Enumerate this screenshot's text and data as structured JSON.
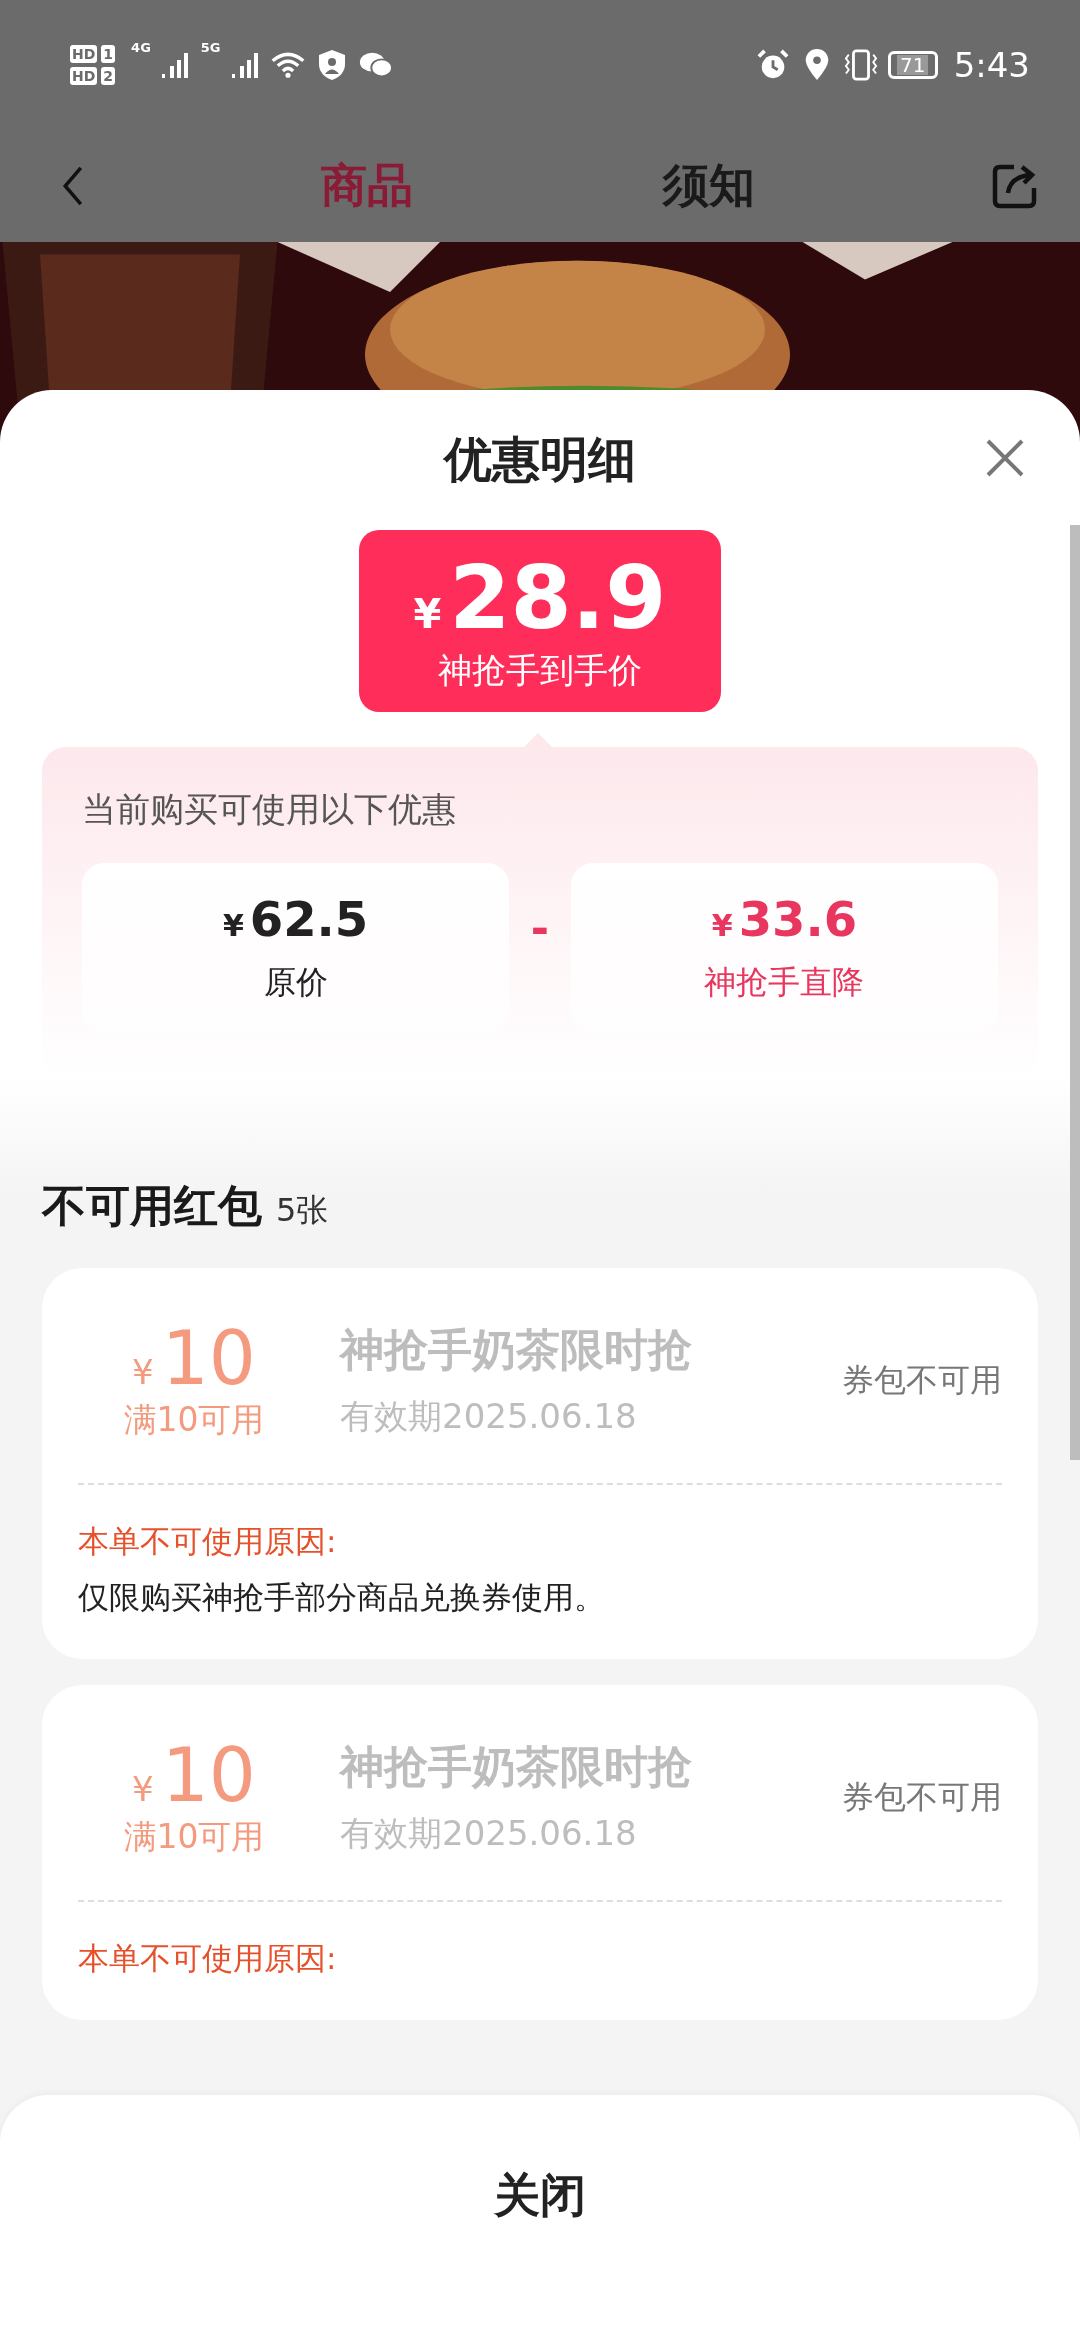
{
  "status_bar": {
    "sims": [
      {
        "hd": "HD",
        "slot": "1",
        "network": "4G"
      },
      {
        "hd": "HD",
        "slot": "2",
        "network": "5G"
      }
    ],
    "battery": "71",
    "time": "5:43"
  },
  "header": {
    "tabs": [
      {
        "label": "商品",
        "selected": true
      },
      {
        "label": "须知",
        "selected": false
      }
    ]
  },
  "sheet": {
    "title": "优惠明细",
    "final_price": {
      "currency": "¥",
      "amount": "28.9",
      "label": "神抢手到手价"
    },
    "discount_panel": {
      "caption": "当前购买可使用以下优惠",
      "operator": "-",
      "items": [
        {
          "currency": "¥",
          "amount": "62.5",
          "label": "原价",
          "kind": "base"
        },
        {
          "currency": "¥",
          "amount": "33.6",
          "label": "神抢手直降",
          "kind": "discount"
        }
      ]
    },
    "unavailable": {
      "title": "不可用红包",
      "count": "5张",
      "coupons": [
        {
          "currency": "¥",
          "amount": "10",
          "condition": "满10可用",
          "name": "神抢手奶茶限时抢",
          "validity": "有效期2025.06.18",
          "status": "券包不可用",
          "disabled": true,
          "reason_label": "本单不可使用原因:",
          "reason": "仅限购买神抢手部分商品兑换券使用。"
        },
        {
          "currency": "¥",
          "amount": "10",
          "condition": "满10可用",
          "name": "神抢手奶茶限时抢",
          "validity": "有效期2025.06.18",
          "status": "券包不可用",
          "disabled": true,
          "reason_label": "本单不可使用原因:"
        }
      ]
    }
  },
  "footer": {
    "close_label": "关闭"
  }
}
